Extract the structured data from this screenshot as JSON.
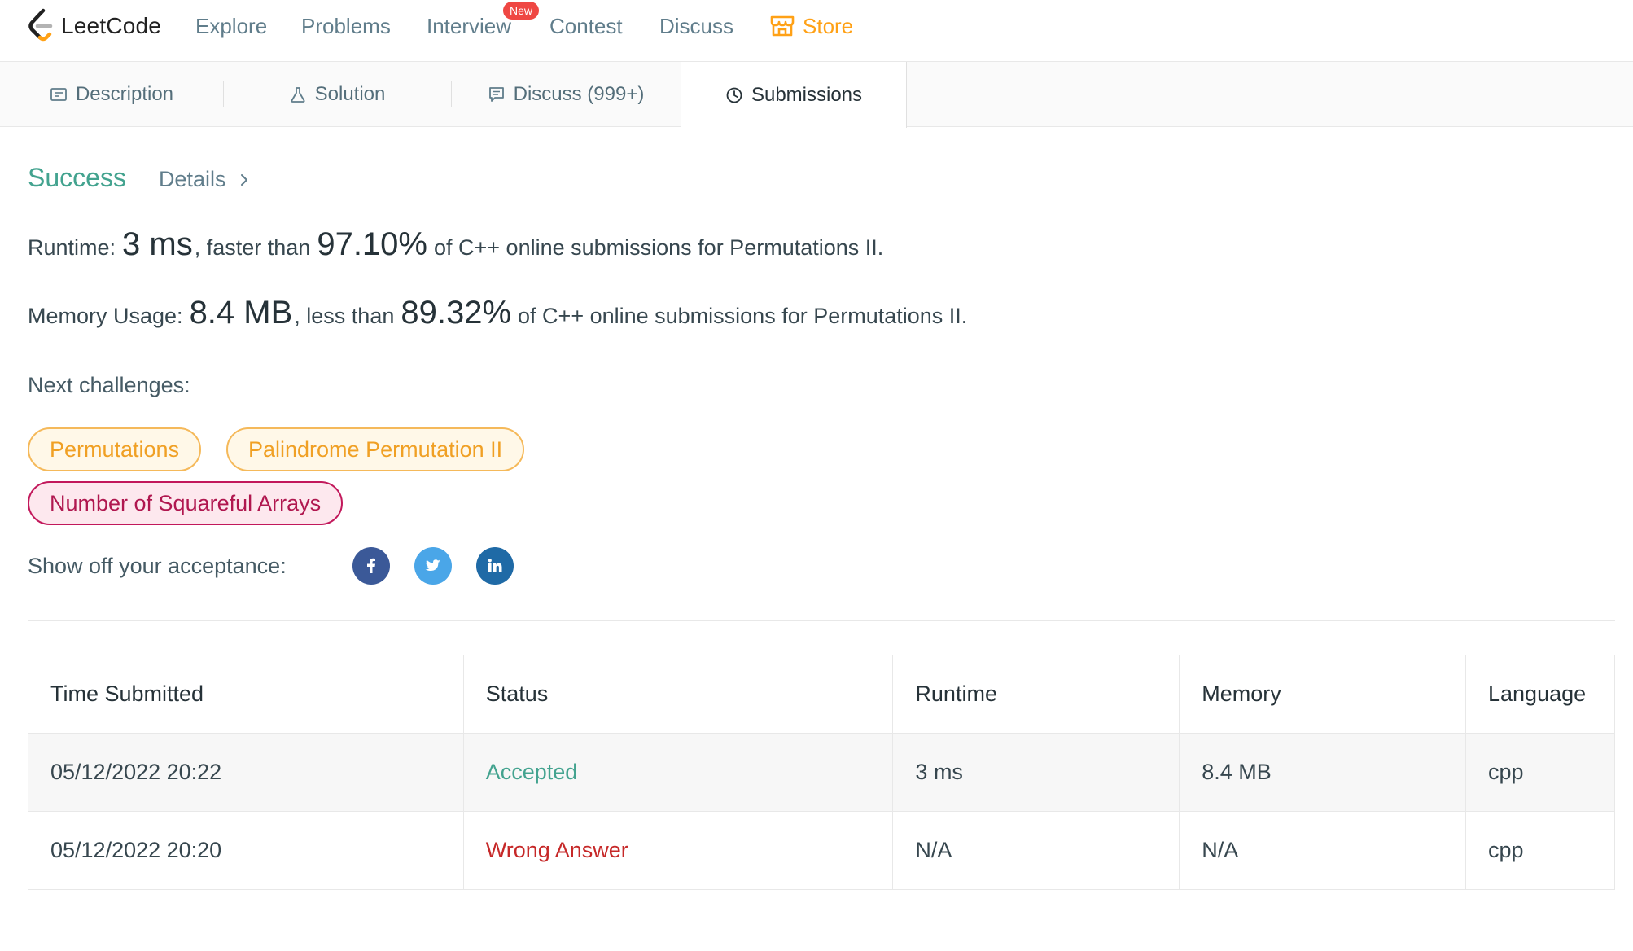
{
  "nav": {
    "logo_text": "LeetCode",
    "items": [
      "Explore",
      "Problems",
      "Interview",
      "Contest",
      "Discuss"
    ],
    "new_badge": "New",
    "store": "Store",
    "store_color": "#ffa116"
  },
  "tabs": {
    "description": "Description",
    "solution": "Solution",
    "discuss": "Discuss (999+)",
    "submissions": "Submissions"
  },
  "result": {
    "status": "Success",
    "details": "Details",
    "runtime_label": "Runtime:",
    "runtime_value": "3 ms",
    "runtime_mid": ", faster than",
    "runtime_pct": "97.10%",
    "runtime_tail": "of C++ online submissions for Permutations II.",
    "memory_label": "Memory Usage:",
    "memory_value": "8.4 MB",
    "memory_mid": ", less than",
    "memory_pct": "89.32%",
    "memory_tail": "of C++ online submissions for Permutations II.",
    "success_color": "#43a38f"
  },
  "next_challenges": {
    "label": "Next challenges:",
    "items": [
      "Permutations",
      "Palindrome Permutation II",
      "Number of Squareful Arrays"
    ]
  },
  "share": {
    "label": "Show off your acceptance:",
    "icons": [
      "facebook-icon",
      "twitter-icon",
      "linkedin-icon"
    ]
  },
  "submissions_table": {
    "headers": [
      "Time Submitted",
      "Status",
      "Runtime",
      "Memory",
      "Language"
    ],
    "rows": [
      [
        "05/12/2022 20:22",
        "Accepted",
        "3 ms",
        "8.4 MB",
        "cpp"
      ],
      [
        "05/12/2022 20:20",
        "Wrong Answer",
        "N/A",
        "N/A",
        "cpp"
      ]
    ]
  }
}
